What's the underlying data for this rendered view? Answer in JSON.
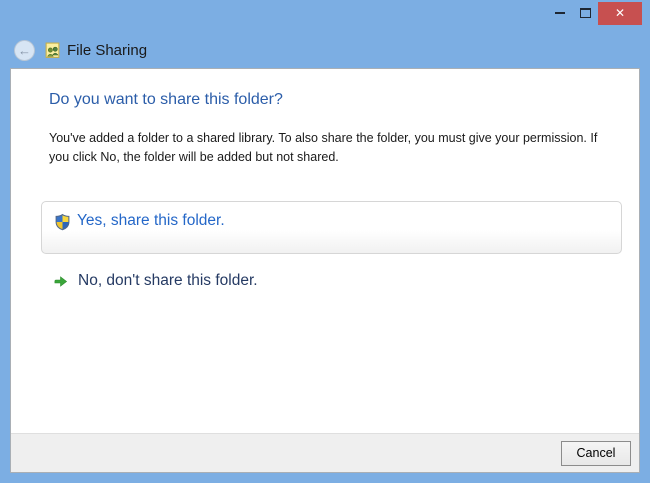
{
  "window": {
    "title": "File Sharing",
    "caption": {
      "close_glyph": "✕",
      "back_glyph": "←"
    }
  },
  "dialog": {
    "heading": "Do you want to share this folder?",
    "body": "You've added a folder to a shared library. To also share the folder, you must give your permission. If you click No, the folder will be added but not shared.",
    "options": [
      {
        "label": "Yes, share this folder.",
        "icon": "uac-shield-icon"
      },
      {
        "label": "No, don't share this folder.",
        "icon": "green-arrow-icon"
      }
    ],
    "footer": {
      "cancel_label": "Cancel"
    }
  },
  "colors": {
    "frame_blue": "#7CAEE3",
    "close_red": "#C75050",
    "heading_blue": "#2B5DA9",
    "link_blue": "#2467C8",
    "no_link_navy": "#253A63",
    "footer_gray": "#EFEFEF"
  }
}
